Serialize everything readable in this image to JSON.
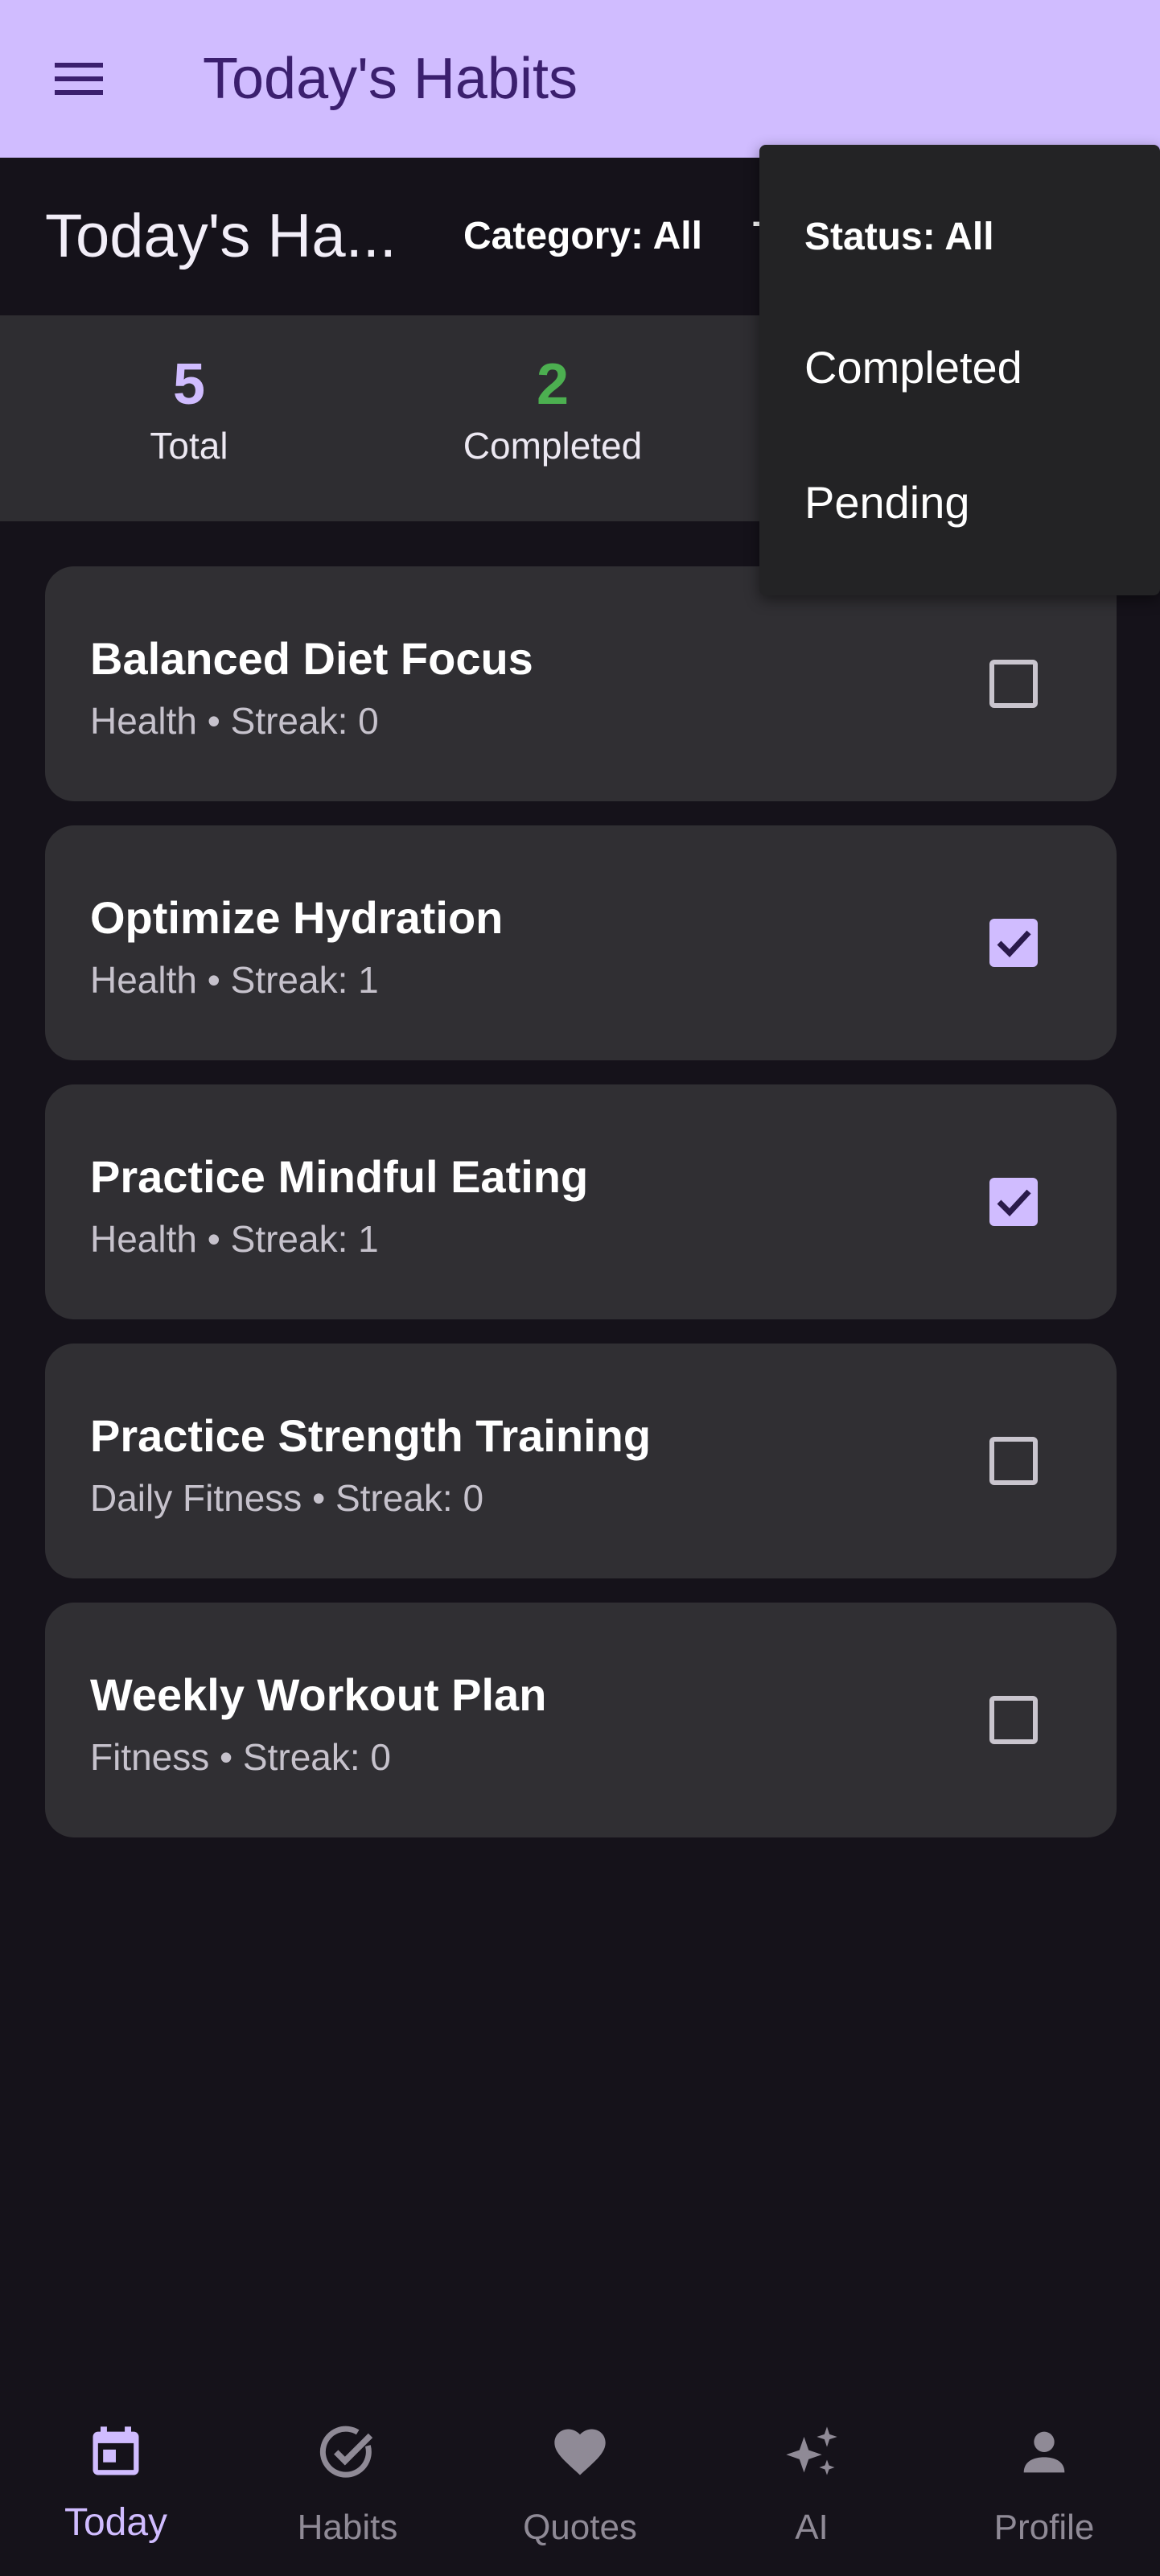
{
  "app_bar": {
    "title": "Today's Habits",
    "menu_icon": "menu-icon"
  },
  "toolbar": {
    "title": "Today's Ha...",
    "category_filter": "Category: All",
    "type_filter_stub": "T"
  },
  "stats": {
    "total": {
      "value": "5",
      "label": "Total",
      "color": "#d0bcff"
    },
    "completed": {
      "value": "2",
      "label": "Completed",
      "color": "#4caf50"
    }
  },
  "status_menu": {
    "options": [
      "Status: All",
      "Completed",
      "Pending"
    ],
    "selected": "Status: All"
  },
  "habits": [
    {
      "name": "Balanced Diet Focus",
      "meta": "Health • Streak: 0",
      "done": false
    },
    {
      "name": "Optimize Hydration",
      "meta": "Health • Streak: 1",
      "done": true
    },
    {
      "name": "Practice Mindful Eating",
      "meta": "Health • Streak: 1",
      "done": true
    },
    {
      "name": "Practice Strength Training",
      "meta": "Daily Fitness • Streak: 0",
      "done": false
    },
    {
      "name": "Weekly Workout Plan",
      "meta": "Fitness • Streak: 0",
      "done": false
    }
  ],
  "bottom_nav": {
    "items": [
      {
        "label": "Today",
        "icon": "calendar-icon",
        "active": true
      },
      {
        "label": "Habits",
        "icon": "check-circle-icon",
        "active": false
      },
      {
        "label": "Quotes",
        "icon": "heart-icon",
        "active": false
      },
      {
        "label": "AI",
        "icon": "sparkle-icon",
        "active": false
      },
      {
        "label": "Profile",
        "icon": "person-icon",
        "active": false
      }
    ]
  },
  "colors": {
    "primary": "#d0bcff",
    "background": "#15121a",
    "surface": "#302f33",
    "completed_green": "#4caf50"
  }
}
